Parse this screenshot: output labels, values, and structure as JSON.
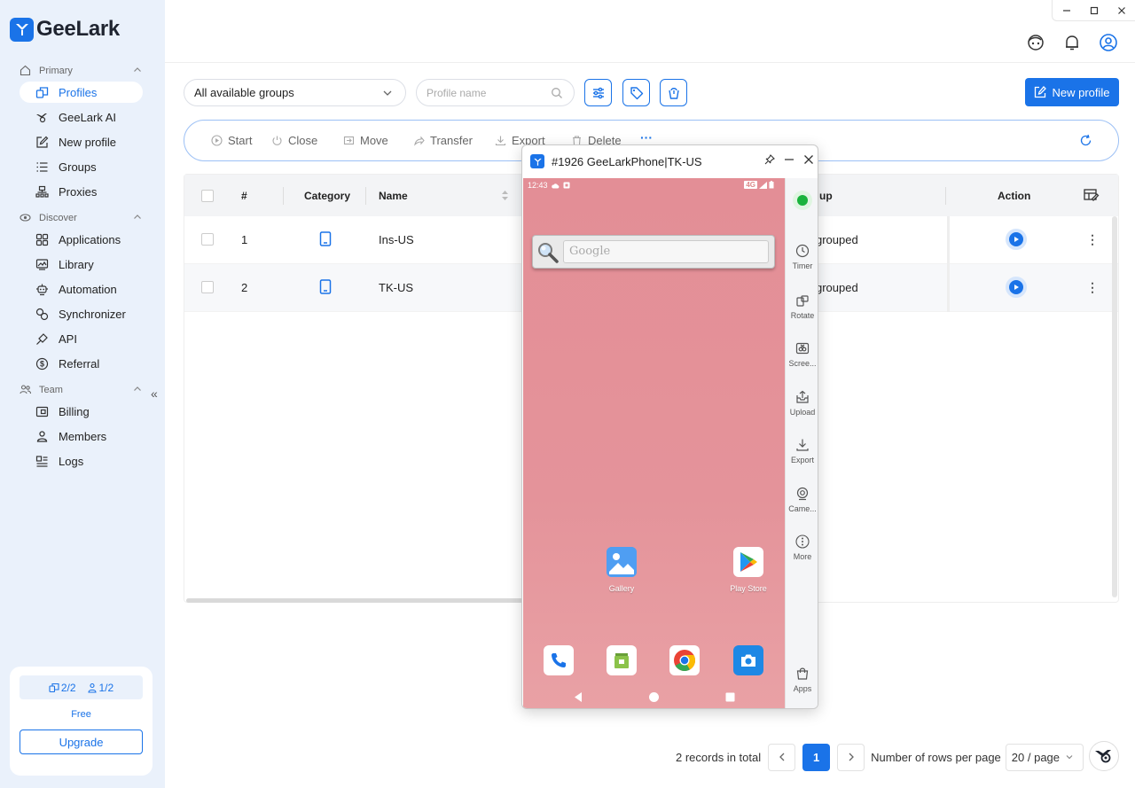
{
  "app": {
    "name": "GeeLark"
  },
  "sidebar": {
    "sections": [
      {
        "label": "Primary"
      },
      {
        "label": "Discover"
      },
      {
        "label": "Team"
      }
    ],
    "items": [
      {
        "label": "Profiles",
        "icon": "profiles-icon"
      },
      {
        "label": "GeeLark AI",
        "icon": "ai-icon"
      },
      {
        "label": "New profile",
        "icon": "edit-icon"
      },
      {
        "label": "Groups",
        "icon": "list-icon"
      },
      {
        "label": "Proxies",
        "icon": "network-icon"
      },
      {
        "label": "Applications",
        "icon": "grid-icon"
      },
      {
        "label": "Library",
        "icon": "library-icon"
      },
      {
        "label": "Automation",
        "icon": "robot-icon"
      },
      {
        "label": "Synchronizer",
        "icon": "sync-icon"
      },
      {
        "label": "API",
        "icon": "api-icon"
      },
      {
        "label": "Referral",
        "icon": "dollar-icon"
      },
      {
        "label": "Billing",
        "icon": "billing-icon"
      },
      {
        "label": "Members",
        "icon": "user-icon"
      },
      {
        "label": "Logs",
        "icon": "logs-icon"
      }
    ],
    "plan": {
      "profiles": "2/2",
      "members": "1/2",
      "name": "Free",
      "upgrade_label": "Upgrade"
    }
  },
  "filters": {
    "group_select": "All available groups",
    "search_placeholder": "Profile name",
    "new_profile_label": "New profile"
  },
  "toolbar": {
    "start": "Start",
    "close": "Close",
    "move": "Move",
    "transfer": "Transfer",
    "export": "Export",
    "delete": "Delete",
    "more": "···"
  },
  "table": {
    "headers": {
      "index": "#",
      "category": "Category",
      "name": "Name",
      "group": "up",
      "action": "Action"
    },
    "rows": [
      {
        "index": "1",
        "name": "Ins-US",
        "group": "grouped"
      },
      {
        "index": "2",
        "name": "TK-US",
        "group": "grouped"
      }
    ]
  },
  "pagination": {
    "total": "2 records in total",
    "current_page": "1",
    "rows_label": "Number of rows per page",
    "rows_value": "20 / page"
  },
  "phone_window": {
    "title": "#1926 GeeLarkPhone|TK-US",
    "status_time": "12:43",
    "network": "4G",
    "search_placeholder": "Google",
    "apps": [
      {
        "label": "Gallery"
      },
      {
        "label": "Play Store"
      }
    ],
    "side_tools": [
      {
        "label": "Timer"
      },
      {
        "label": "Rotate"
      },
      {
        "label": "Scree..."
      },
      {
        "label": "Upload"
      },
      {
        "label": "Export"
      },
      {
        "label": "Came..."
      },
      {
        "label": "More"
      },
      {
        "label": "Apps"
      }
    ]
  },
  "colors": {
    "accent": "#1a73e8",
    "sidebar_bg": "#eaf1fb",
    "online": "#19b33c"
  }
}
